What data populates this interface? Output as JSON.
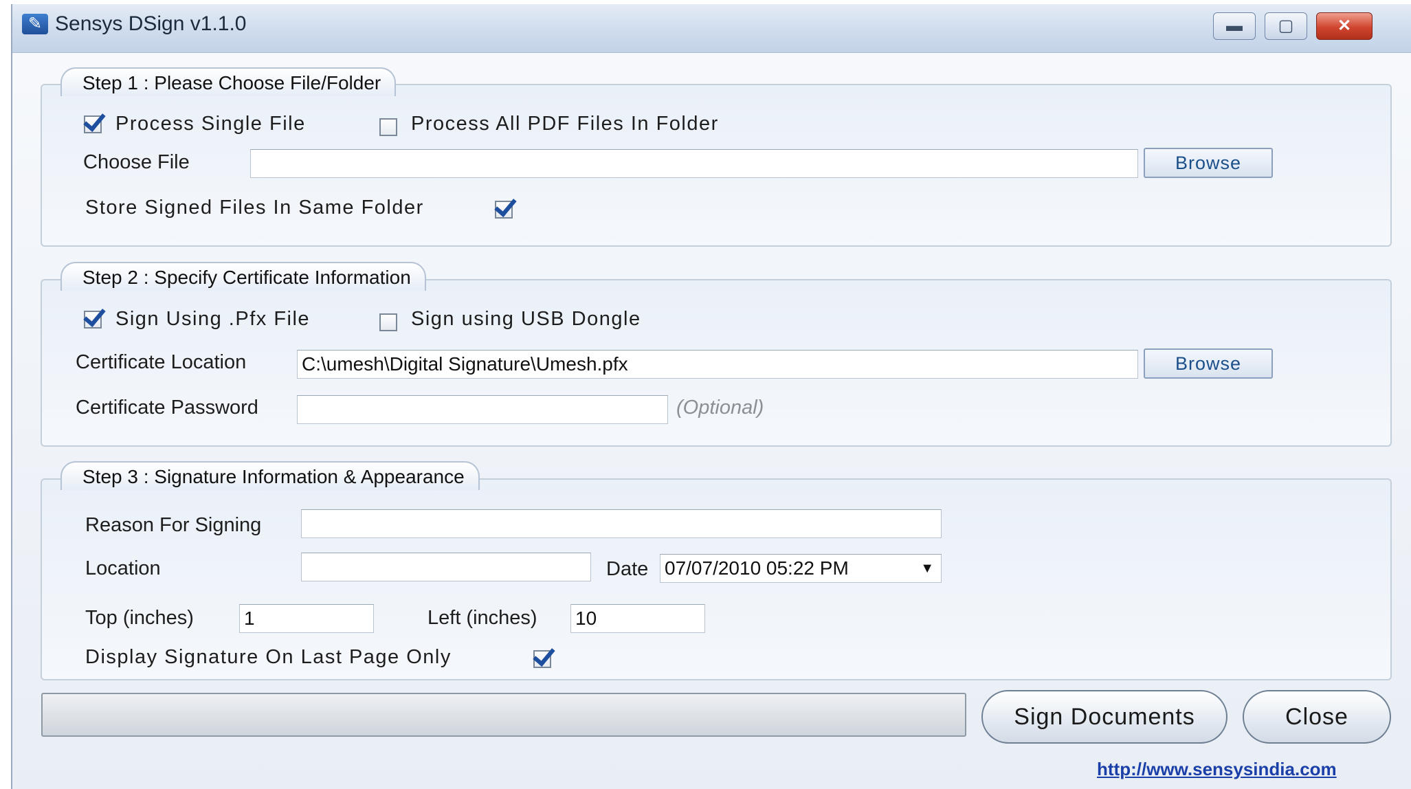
{
  "window": {
    "title": "Sensys DSign v1.1.0"
  },
  "step1": {
    "title": "Step 1 : Please Choose File/Folder",
    "single_file_label": "Process Single File",
    "single_file_checked": true,
    "folder_label": "Process All PDF Files In Folder",
    "folder_checked": false,
    "choose_file_label": "Choose File",
    "choose_file_value": "",
    "browse_label": "Browse",
    "store_same_folder_label": "Store Signed Files In Same Folder",
    "store_same_folder_checked": true
  },
  "step2": {
    "title": "Step 2 : Specify Certificate Information",
    "pfx_label": "Sign Using .Pfx File",
    "pfx_checked": true,
    "usb_label": "Sign using USB Dongle",
    "usb_checked": false,
    "cert_location_label": "Certificate Location",
    "cert_location_value": "C:\\umesh\\Digital Signature\\Umesh.pfx",
    "browse_label": "Browse",
    "cert_password_label": "Certificate Password",
    "cert_password_value": "",
    "optional_note": "(Optional)"
  },
  "step3": {
    "title": "Step 3 : Signature Information & Appearance",
    "reason_label": "Reason For Signing",
    "reason_value": "",
    "location_label": "Location",
    "location_value": "",
    "date_label": "Date",
    "date_value": "07/07/2010   05:22  PM",
    "top_label": "Top (inches)",
    "top_value": "1",
    "left_label": "Left (inches)",
    "left_value": "10",
    "last_page_label": "Display Signature On Last Page Only",
    "last_page_checked": true
  },
  "footer": {
    "progress": 0,
    "sign_button": "Sign Documents",
    "close_button": "Close",
    "link": "http://www.sensysindia.com"
  }
}
